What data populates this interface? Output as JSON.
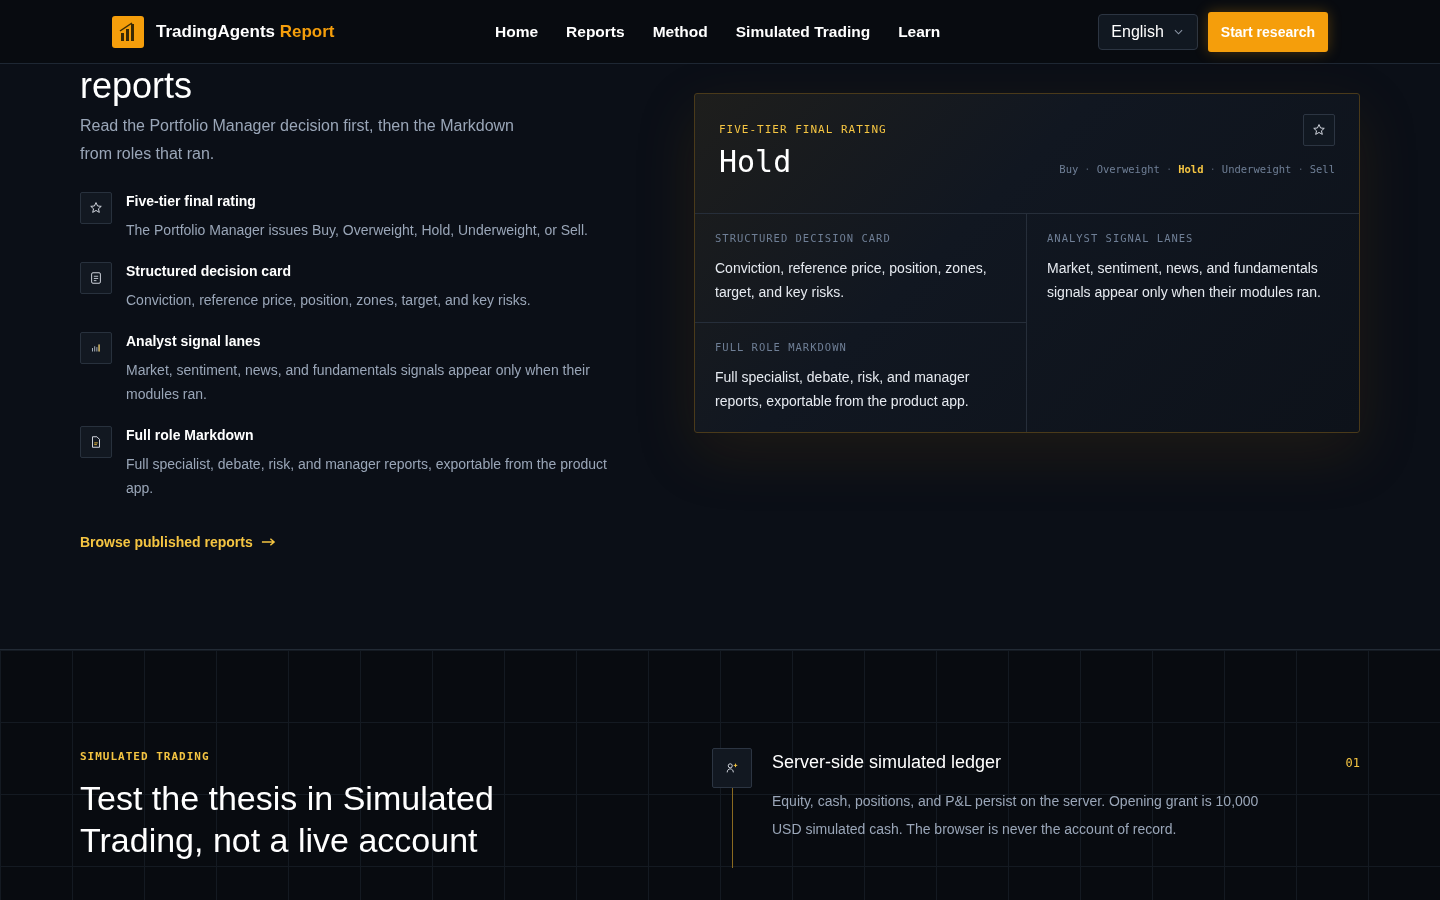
{
  "header": {
    "brand": "TradingAgents",
    "brand_accent": "Report",
    "nav": [
      {
        "label": "Home"
      },
      {
        "label": "Reports"
      },
      {
        "label": "Method"
      },
      {
        "label": "Simulated Trading"
      },
      {
        "label": "Learn"
      }
    ],
    "language": "English",
    "cta": "Start research"
  },
  "intro": {
    "heading_tail": "reports",
    "lead": "Read the Portfolio Manager decision first, then the Markdown from roles that ran.",
    "features": [
      {
        "kind": "star",
        "title": "Five-tier final rating",
        "text": "The Portfolio Manager issues Buy, Overweight, Hold, Underweight, or Sell."
      },
      {
        "kind": "card",
        "title": "Structured decision card",
        "text": "Conviction, reference price, position, zones, target, and key risks."
      },
      {
        "kind": "bars",
        "title": "Analyst signal lanes",
        "text": "Market, sentiment, news, and fundamentals signals appear only when their modules ran."
      },
      {
        "kind": "doc",
        "title": "Full role Markdown",
        "text": "Full specialist, debate, risk, and manager reports, exportable from the product app."
      }
    ],
    "link": "Browse published reports"
  },
  "rating_card": {
    "eyebrow": "FIVE-TIER FINAL RATING",
    "rating": "Hold",
    "separator": "·",
    "tiers": [
      {
        "label": "Buy",
        "selected": false
      },
      {
        "label": "Overweight",
        "selected": false
      },
      {
        "label": "Hold",
        "selected": true
      },
      {
        "label": "Underweight",
        "selected": false
      },
      {
        "label": "Sell",
        "selected": false
      }
    ],
    "cells": [
      {
        "label": "STRUCTURED DECISION CARD",
        "text": "Conviction, reference price, position, zones, target, and key risks."
      },
      {
        "label": "ANALYST SIGNAL LANES",
        "text": "Market, sentiment, news, and fundamentals signals appear only when their modules ran."
      },
      {
        "label": "FULL ROLE MARKDOWN",
        "text": "Full specialist, debate, risk, and manager reports, exportable from the product app."
      }
    ]
  },
  "simulated": {
    "eyebrow": "SIMULATED TRADING",
    "heading": "Test the thesis in Simulated Trading, not a live account",
    "steps": [
      {
        "title": "Server-side simulated ledger",
        "number": "01",
        "text": "Equity, cash, positions, and P&L persist on the server. Opening grant is 10,000 USD simulated cash. The browser is never the account of record."
      }
    ]
  }
}
